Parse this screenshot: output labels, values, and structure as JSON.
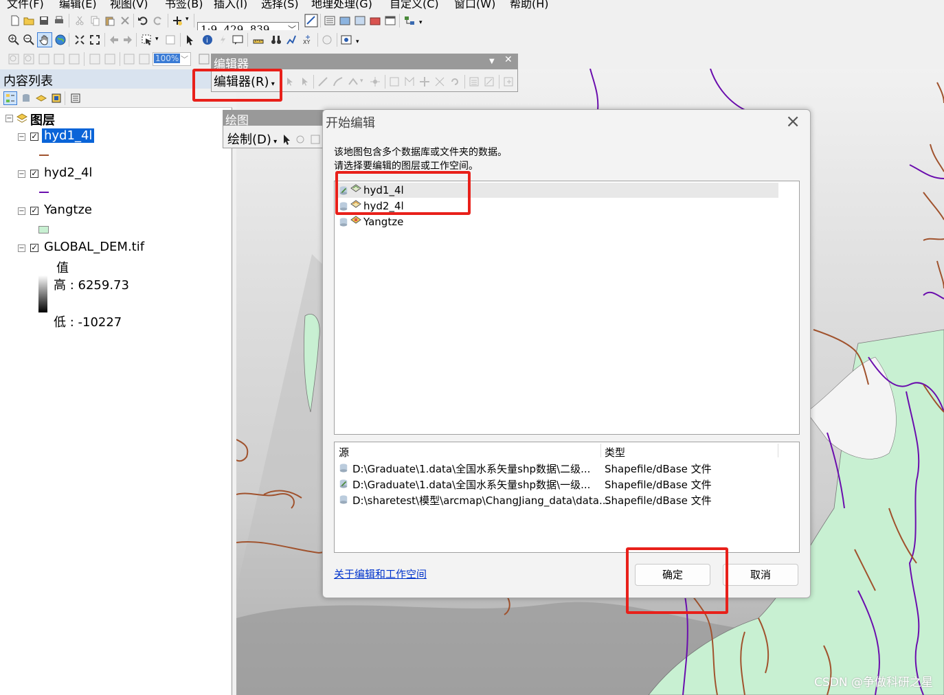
{
  "menubar": {
    "items": [
      "文件(F)",
      "编辑(E)",
      "视图(V)",
      "书签(B)",
      "插入(I)",
      "选择(S)",
      "地理处理(G)",
      "自定义(C)",
      "窗口(W)",
      "帮助(H)"
    ]
  },
  "toolbar": {
    "scale": "1:9, 429, 839",
    "zoom_percent": "100%"
  },
  "toc": {
    "title": "内容列表",
    "group": "图层",
    "layers": [
      {
        "name": "hyd1_4l",
        "checked": true,
        "selected": true,
        "color": "#a0522d"
      },
      {
        "name": "hyd2_4l",
        "checked": true,
        "selected": false,
        "color": "#6a0dad"
      },
      {
        "name": "Yangtze",
        "checked": true,
        "selected": false,
        "color": "#c8f0d2"
      },
      {
        "name": "GLOBAL_DEM.tif",
        "checked": true,
        "selected": false
      }
    ],
    "dem_legend": {
      "heading": "值",
      "high": "高 : 6259.73",
      "low": "低 : -10227"
    }
  },
  "editor_toolbar": {
    "title": "编辑器",
    "menu_label": "编辑器(R)"
  },
  "draw_toolbar": {
    "title": "绘图",
    "menu_label": "绘制(D)"
  },
  "dialog": {
    "title": "开始编辑",
    "desc_line1": "该地图包含多个数据库或文件夹的数据。",
    "desc_line2": "请选择要编辑的图层或工作空间。",
    "workspaces": [
      "hyd1_4l",
      "hyd2_4l",
      "Yangtze"
    ],
    "source_header": "源",
    "type_header": "类型",
    "sources": [
      {
        "path": "D:\\Graduate\\1.data\\全国水系矢量shp数据\\二级...",
        "type": "Shapefile/dBase 文件"
      },
      {
        "path": "D:\\Graduate\\1.data\\全国水系矢量shp数据\\一级...",
        "type": "Shapefile/dBase 文件"
      },
      {
        "path": "D:\\sharetest\\模型\\arcmap\\ChangJiang_data\\data...",
        "type": "Shapefile/dBase 文件"
      }
    ],
    "help_link": "关于编辑和工作空间",
    "ok_label": "确定",
    "cancel_label": "取消"
  },
  "watermark": "CSDN @争做科研之星"
}
